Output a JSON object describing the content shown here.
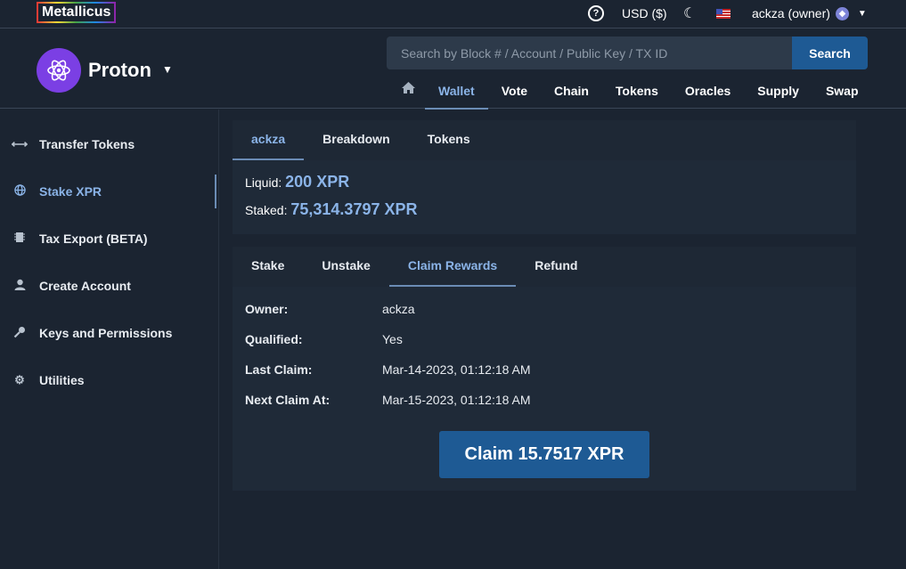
{
  "topbar": {
    "brand": "Metallicus",
    "currency": "USD ($)",
    "user": "ackza (owner)"
  },
  "header": {
    "app_name": "Proton",
    "search_placeholder": "Search by Block # / Account / Public Key / TX ID",
    "search_button": "Search",
    "nav": [
      "Wallet",
      "Vote",
      "Chain",
      "Tokens",
      "Oracles",
      "Supply",
      "Swap"
    ],
    "active_nav": "Wallet"
  },
  "sidebar": {
    "items": [
      {
        "label": "Transfer Tokens",
        "icon": "arrows-horizontal-icon"
      },
      {
        "label": "Stake XPR",
        "icon": "globe-icon"
      },
      {
        "label": "Tax Export (BETA)",
        "icon": "chip-icon"
      },
      {
        "label": "Create Account",
        "icon": "user-icon"
      },
      {
        "label": "Keys and Permissions",
        "icon": "key-icon"
      },
      {
        "label": "Utilities",
        "icon": "gear-icon"
      }
    ],
    "active": "Stake XPR"
  },
  "account_panel": {
    "tabs": [
      "ackza",
      "Breakdown",
      "Tokens"
    ],
    "liquid_label": "Liquid:",
    "liquid_value": "200 XPR",
    "staked_label": "Staked:",
    "staked_value": "75,314.3797 XPR"
  },
  "stake_panel": {
    "tabs": [
      "Stake",
      "Unstake",
      "Claim Rewards",
      "Refund"
    ],
    "active_tab": "Claim Rewards",
    "rows": [
      {
        "key": "Owner:",
        "value": "ackza"
      },
      {
        "key": "Qualified:",
        "value": "Yes"
      },
      {
        "key": "Last Claim:",
        "value": "Mar-14-2023, 01:12:18 AM"
      },
      {
        "key": "Next Claim At:",
        "value": "Mar-15-2023, 01:12:18 AM"
      }
    ],
    "claim_button": "Claim 15.7517 XPR"
  },
  "colors": {
    "accent": "#8bb4e8",
    "button": "#1e5a94",
    "background": "#1b2431",
    "panel": "#1f2a38",
    "logo": "#7b3fe4"
  }
}
